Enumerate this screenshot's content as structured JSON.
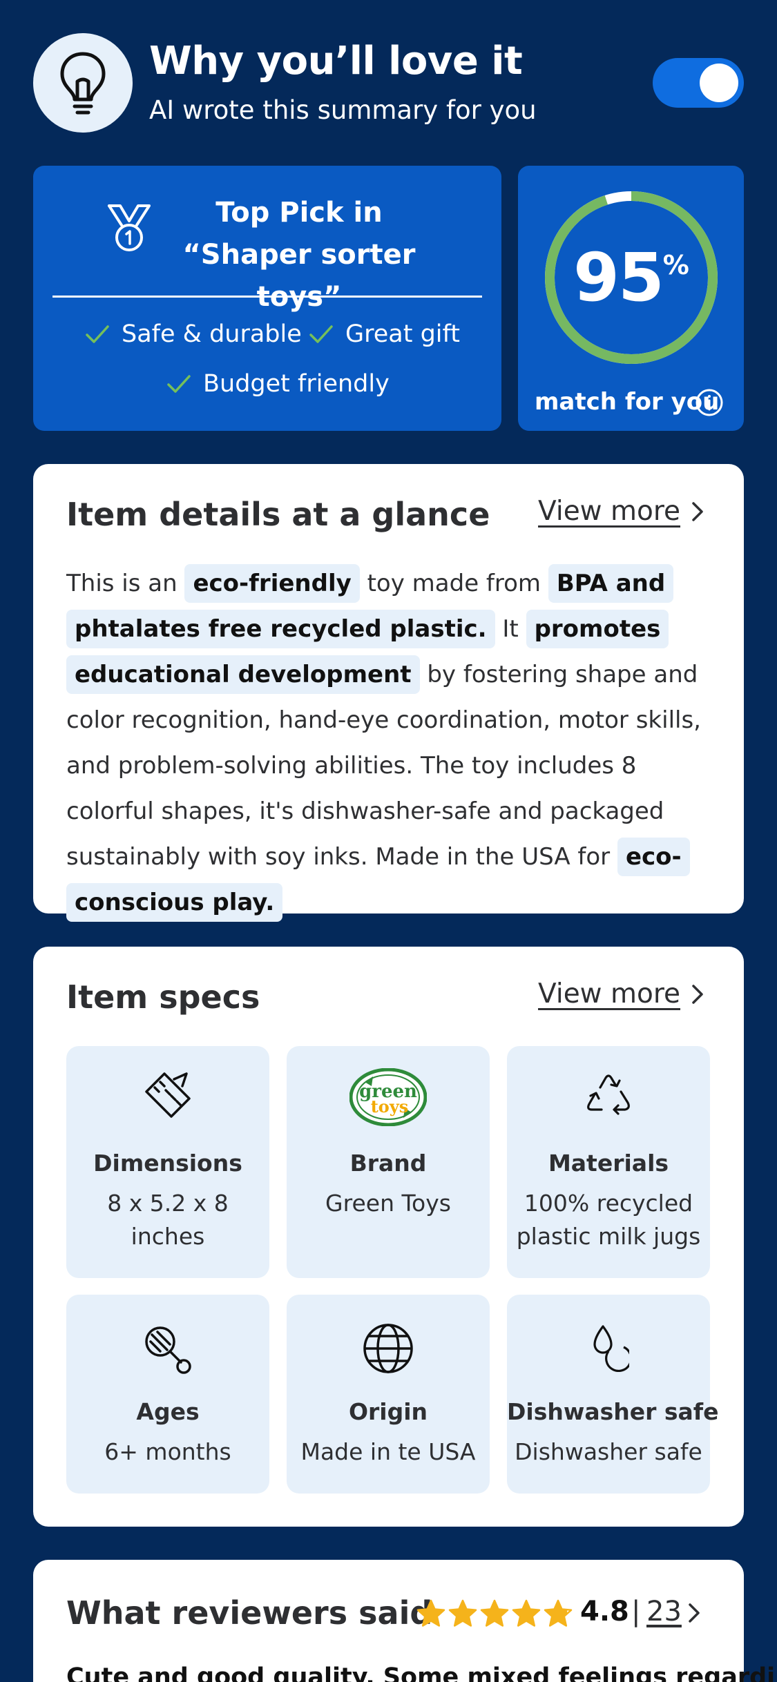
{
  "header": {
    "title": "Why you’ll love it",
    "subtitle": "AI wrote this summary for you",
    "icon": "lightbulb-icon",
    "toggle_on": true
  },
  "top_pick": {
    "title_line1": "Top Pick in",
    "title_line2": "“Shaper sorter toys”",
    "icon": "medal-icon",
    "tags": [
      "Safe & durable",
      "Great gift",
      "Budget friendly"
    ]
  },
  "match": {
    "percent": "95",
    "percent_sign": "%",
    "label": "match for you",
    "icon": "info-icon",
    "fraction": 0.95
  },
  "details": {
    "title": "Item details at a glance",
    "view_more": "View more",
    "t1": "This is an ",
    "h1": "eco-friendly",
    "t2": " toy made from ",
    "h2": "BPA and phtalates free recycled plastic.",
    "t3": " It ",
    "h3": "promotes educational development",
    "t4": " by fostering shape and color recognition, hand-eye coordination, motor skills, and problem-solving abilities. The toy includes 8 colorful shapes, it's dishwasher-safe and packaged sustainably with soy inks. Made in the USA for ",
    "h4": "eco-conscious play."
  },
  "specs": {
    "title": "Item specs",
    "view_more": "View more",
    "items": [
      {
        "label": "Dimensions",
        "value": "8 x 5.2 x 8 inches",
        "icon": "ruler-icon"
      },
      {
        "label": "Brand",
        "value": "Green Toys",
        "icon": "green-toys-logo",
        "logo_line1": "green",
        "logo_line2": "toys"
      },
      {
        "label": "Materials",
        "value": "100% recycled plastic milk jugs",
        "icon": "recycle-icon"
      },
      {
        "label": "Ages",
        "value": "6+ months",
        "icon": "rattle-icon"
      },
      {
        "label": "Origin",
        "value": "Made in te USA",
        "icon": "globe-icon"
      },
      {
        "label": "Dishwasher safe",
        "value": "Dishwasher safe",
        "icon": "water-drops-icon"
      }
    ]
  },
  "reviews": {
    "title": "What reviewers said",
    "rating": "4.8",
    "rating_value": 4.8,
    "separator": "|",
    "count": "23",
    "snippet": "Cute and good quality. Some mixed feelings regarding",
    "colors": {
      "star": "#f5b31b"
    }
  },
  "colors": {
    "background": "#04295a",
    "card_blue": "#0a5ac2",
    "toggle": "#0f6de0",
    "highlight": "#e6f0fa",
    "ring_green": "#76b862",
    "check_green": "#76c05a"
  }
}
